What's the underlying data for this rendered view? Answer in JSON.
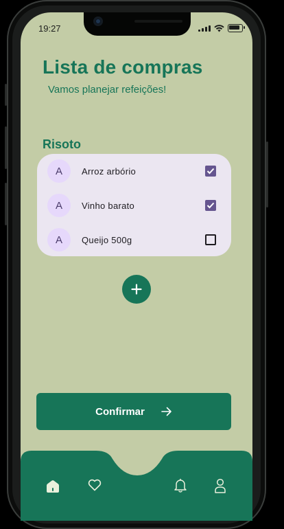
{
  "status_bar": {
    "time": "19:27"
  },
  "header": {
    "title": "Lista de compras",
    "subtitle": "Vamos planejar refeições!"
  },
  "list": {
    "title": "Risoto",
    "items": [
      {
        "avatar": "A",
        "label": "Arroz arbório",
        "checked": true
      },
      {
        "avatar": "A",
        "label": "Vinho barato",
        "checked": true
      },
      {
        "avatar": "A",
        "label": "Queijo 500g",
        "checked": false
      }
    ]
  },
  "actions": {
    "add_icon": "plus-icon",
    "confirm_label": "Confirmar",
    "confirm_icon": "arrow-right-icon"
  },
  "tab_bar": {
    "items": [
      {
        "icon": "home-icon",
        "active": true
      },
      {
        "icon": "heart-icon",
        "active": false
      },
      {
        "icon": "bell-icon",
        "active": false
      },
      {
        "icon": "user-icon",
        "active": false
      }
    ]
  },
  "colors": {
    "primary": "#177558",
    "background": "#c3cca6",
    "card": "#ebe6f1",
    "avatar": "#e6d8fb",
    "checkbox": "#65558f"
  }
}
